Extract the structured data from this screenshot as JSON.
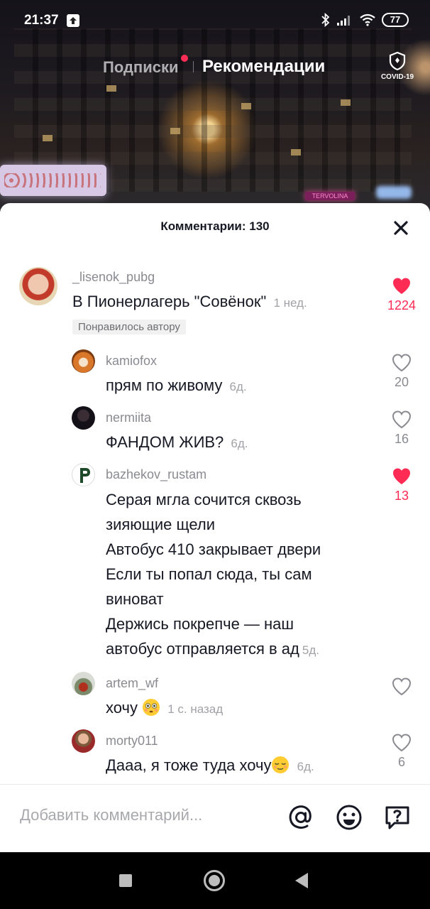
{
  "status_bar": {
    "time": "21:37",
    "battery": "77"
  },
  "top_nav": {
    "following": "Подписки",
    "for_you": "Рекомендации",
    "covid_label": "COVID-19"
  },
  "video": {
    "shop_sign": "TERVOLINA"
  },
  "comments_sheet": {
    "title": "Комментарии: 130",
    "comments": [
      {
        "username": "_lisenok_pubg",
        "text": "В Пионерлагерь \"Совёнок\"",
        "time": "1 нед.",
        "badge": "Понравилось автору",
        "likes": "1224",
        "liked": true
      },
      {
        "username": "kamiofox",
        "text": "прям по живому",
        "time": "6д.",
        "likes": "20",
        "liked": false
      },
      {
        "username": "nermiita",
        "text": "ФАНДОМ ЖИВ?",
        "time": "6д.",
        "likes": "16",
        "liked": false
      },
      {
        "username": "bazhekov_rustam",
        "lines": [
          "Серая мгла сочится сквозь",
          "зияющие щели",
          "Автобус 410 закрывает двери",
          "Если ты попал сюда, ты сам",
          "виноват",
          "Держись покрепче — наш",
          "автобус отправляется в ад"
        ],
        "time": "5д.",
        "likes": "13",
        "liked": true
      },
      {
        "username": "artem_wf",
        "text": "хочу",
        "time": "1 с. назад",
        "likes": "",
        "liked": false
      },
      {
        "username": "morty011",
        "text": "Дааа, я тоже туда хочу",
        "time": "6д.",
        "likes": "6",
        "liked": false
      }
    ],
    "input_placeholder": "Добавить комментарий..."
  },
  "colors": {
    "accent": "#fe2c55",
    "text": "#161823",
    "muted": "#8a8b91"
  }
}
